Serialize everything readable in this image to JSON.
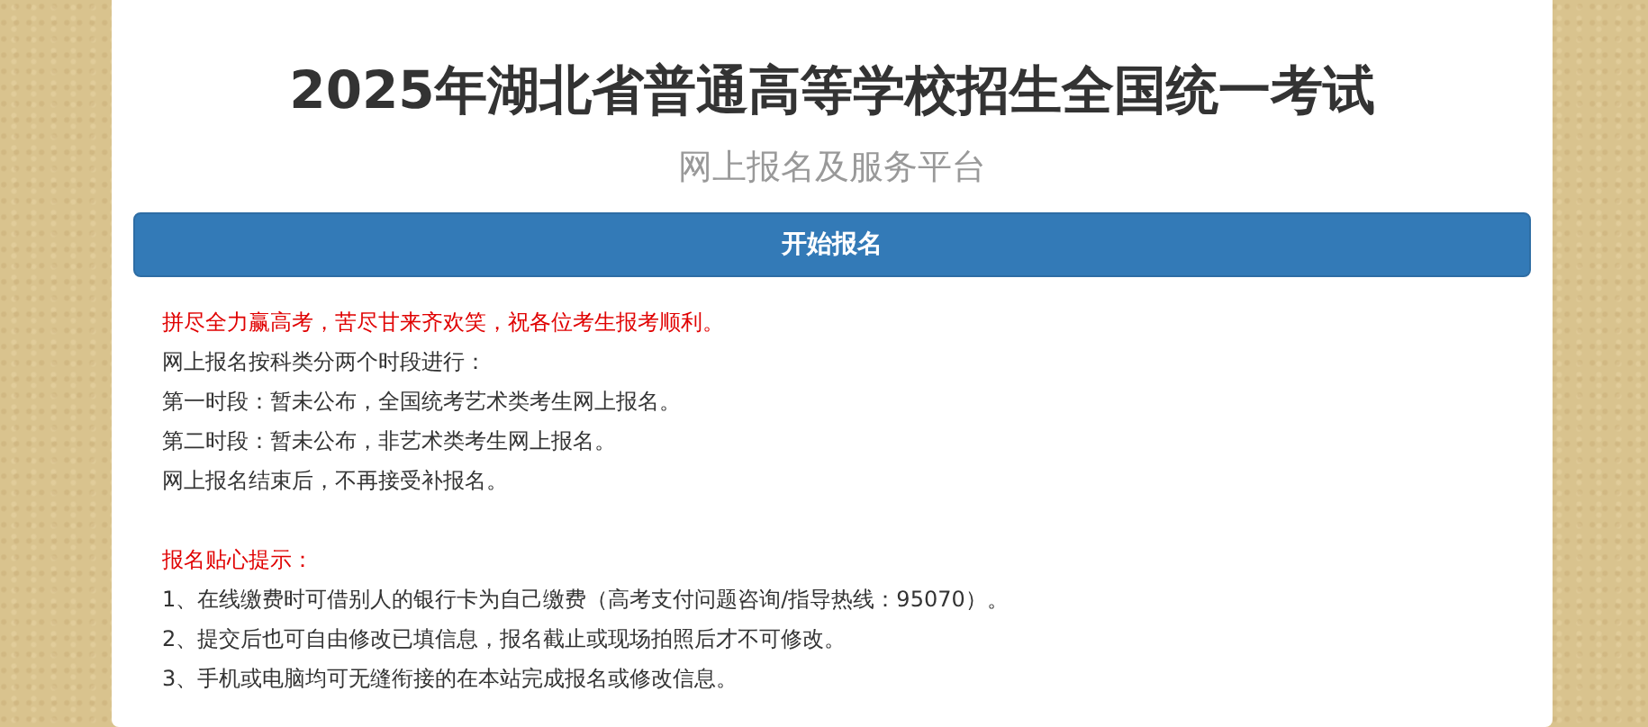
{
  "header": {
    "title": "2025年湖北省普通高等学校招生全国统一考试",
    "subtitle": "网上报名及服务平台"
  },
  "start_button": {
    "label": "开始报名"
  },
  "notice_sections": [
    {
      "lines": [
        {
          "kind": "highlight",
          "text": "拼尽全力赢高考，苦尽甘来齐欢笑，祝各位考生报考顺利。"
        },
        {
          "kind": "normal",
          "text": "网上报名按科类分两个时段进行："
        },
        {
          "kind": "normal",
          "text": "第一时段：暂未公布，全国统考艺术类考生网上报名。"
        },
        {
          "kind": "normal",
          "text": "第二时段：暂未公布，非艺术类考生网上报名。"
        },
        {
          "kind": "normal",
          "text": "网上报名结束后，不再接受补报名。"
        }
      ]
    },
    {
      "lines": [
        {
          "kind": "highlight",
          "text": "报名贴心提示："
        },
        {
          "kind": "normal",
          "text": "1、在线缴费时可借别人的银行卡为自己缴费（高考支付问题咨询/指导热线：95070）。"
        },
        {
          "kind": "normal",
          "text": "2、提交后也可自由修改已填信息，报名截止或现场拍照后才不可修改。"
        },
        {
          "kind": "normal",
          "text": "3、手机或电脑均可无缝衔接的在本站完成报名或修改信息。"
        }
      ]
    }
  ]
}
